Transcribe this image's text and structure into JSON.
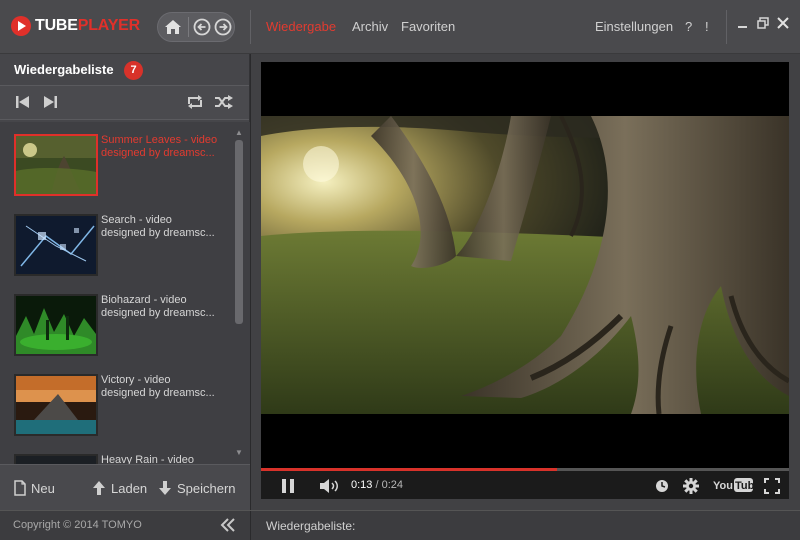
{
  "app": {
    "logo_tube": "TUBE",
    "logo_player": "PLAYER"
  },
  "colors": {
    "accent": "#e0302a",
    "background": "#46464a",
    "titlebar": "#4a4a4d"
  },
  "nav": {
    "tabs": [
      {
        "label": "Wiedergabe",
        "active": true
      },
      {
        "label": "Archiv",
        "active": false
      },
      {
        "label": "Favoriten",
        "active": false
      }
    ],
    "settings_label": "Einstellungen",
    "help_label": "?",
    "info_label": "!",
    "icons": [
      "home-icon",
      "back-icon",
      "forward-icon"
    ]
  },
  "window_controls": [
    "minimize-icon",
    "maximize-icon",
    "close-icon"
  ],
  "playlist": {
    "title": "Wiedergabeliste",
    "count": "7",
    "controls": [
      "previous-icon",
      "next-icon",
      "repeat-icon",
      "shuffle-icon"
    ],
    "items": [
      {
        "line1": "Summer Leaves - video",
        "line2": "designed by dreamsc...",
        "selected": true,
        "thumb": "summer-leaves"
      },
      {
        "line1": "Search - video",
        "line2": "designed by dreamsc...",
        "selected": false,
        "thumb": "search"
      },
      {
        "line1": "Biohazard - video",
        "line2": "designed by dreamsc...",
        "selected": false,
        "thumb": "biohazard"
      },
      {
        "line1": "Victory - video",
        "line2": "designed by dreamsc...",
        "selected": false,
        "thumb": "victory"
      },
      {
        "line1": "Heavy Rain - video",
        "line2": "",
        "selected": false,
        "thumb": "heavy-rain"
      }
    ],
    "actions": {
      "new_label": "Neu",
      "load_label": "Laden",
      "save_label": "Speichern"
    }
  },
  "player": {
    "current_time": "0:13",
    "separator": " / ",
    "duration": "0:24",
    "progress": 0.56,
    "youtube_label": "YouTube"
  },
  "status": {
    "copyright": "Copyright © 2014 TOMYO",
    "playlist_label": "Wiedergabeliste:"
  }
}
